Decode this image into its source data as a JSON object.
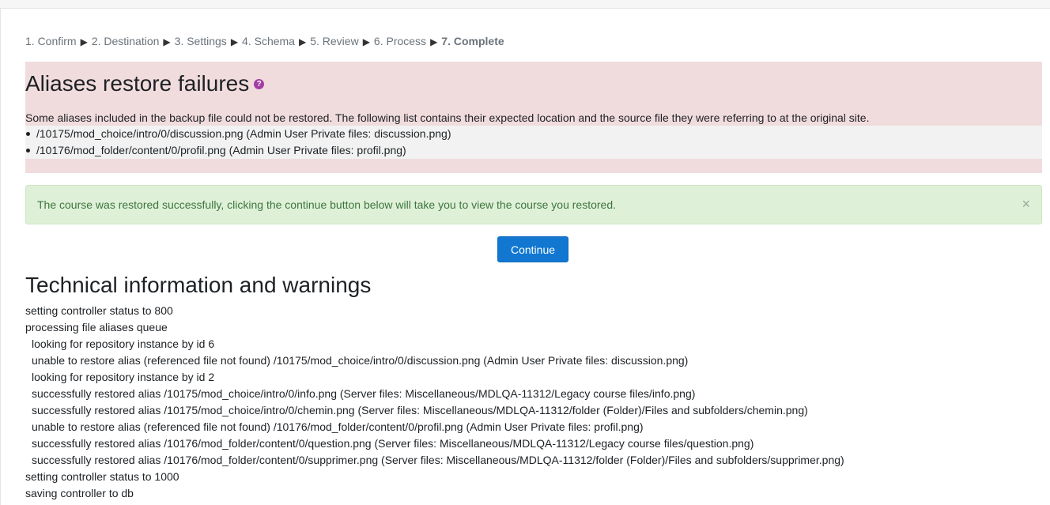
{
  "steps": [
    {
      "label": "1. Confirm",
      "current": false
    },
    {
      "label": "2. Destination",
      "current": false
    },
    {
      "label": "3. Settings",
      "current": false
    },
    {
      "label": "4. Schema",
      "current": false
    },
    {
      "label": "5. Review",
      "current": false
    },
    {
      "label": "6. Process",
      "current": false
    },
    {
      "label": "7. Complete",
      "current": true
    }
  ],
  "step_separator": "▶",
  "aliases": {
    "title": "Aliases restore failures",
    "help_icon": "?",
    "description": "Some aliases included in the backup file could not be restored. The following list contains their expected location and the source file they were referring to at the original site.",
    "items": [
      "/10175/mod_choice/intro/0/discussion.png (Admin User Private files: discussion.png)",
      "/10176/mod_folder/content/0/profil.png (Admin User Private files: profil.png)"
    ]
  },
  "success_alert": {
    "message": "The course was restored successfully, clicking the continue button below will take you to view the course you restored.",
    "close_label": "×"
  },
  "continue_label": "Continue",
  "technical": {
    "title": "Technical information and warnings",
    "lines": [
      {
        "text": "setting controller status to 800",
        "indent": false
      },
      {
        "text": "processing file aliases queue",
        "indent": false
      },
      {
        "text": "looking for repository instance by id 6",
        "indent": true
      },
      {
        "text": "unable to restore alias (referenced file not found) /10175/mod_choice/intro/0/discussion.png (Admin User Private files: discussion.png)",
        "indent": true
      },
      {
        "text": "looking for repository instance by id 2",
        "indent": true
      },
      {
        "text": "successfully restored alias /10175/mod_choice/intro/0/info.png (Server files: Miscellaneous/MDLQA-11312/Legacy course files/info.png)",
        "indent": true
      },
      {
        "text": "successfully restored alias /10175/mod_choice/intro/0/chemin.png (Server files: Miscellaneous/MDLQA-11312/folder (Folder)/Files and subfolders/chemin.png)",
        "indent": true
      },
      {
        "text": "unable to restore alias (referenced file not found) /10176/mod_folder/content/0/profil.png (Admin User Private files: profil.png)",
        "indent": true
      },
      {
        "text": "successfully restored alias /10176/mod_folder/content/0/question.png (Server files: Miscellaneous/MDLQA-11312/Legacy course files/question.png)",
        "indent": true
      },
      {
        "text": "successfully restored alias /10176/mod_folder/content/0/supprimer.png (Server files: Miscellaneous/MDLQA-11312/folder (Folder)/Files and subfolders/supprimer.png)",
        "indent": true
      },
      {
        "text": "setting controller status to 1000",
        "indent": false
      },
      {
        "text": "saving controller to db",
        "indent": false
      }
    ]
  },
  "colors": {
    "alias_bg": "#f1dcdd",
    "success_bg": "#dff0d8",
    "success_text": "#3c763d",
    "button_bg": "#1177d1",
    "help_icon": "#a33ea3"
  }
}
